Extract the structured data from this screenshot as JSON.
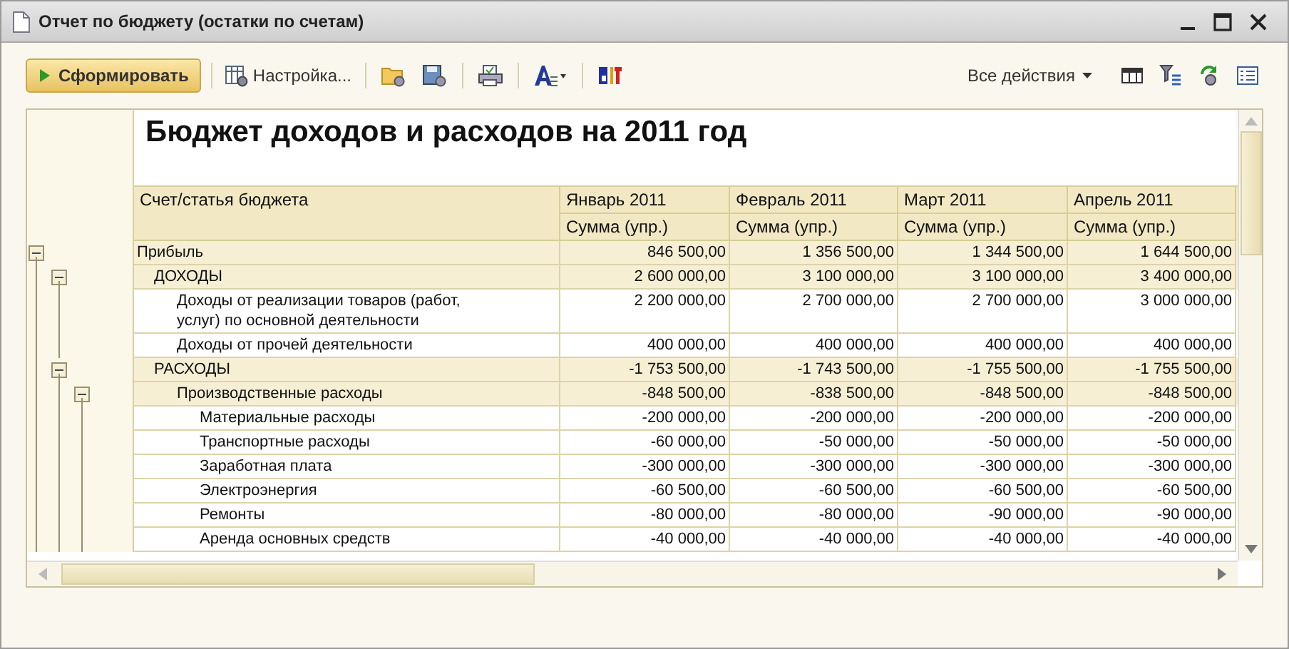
{
  "window": {
    "title": "Отчет по бюджету (остатки по счетам)"
  },
  "toolbar": {
    "generate_button": "Сформировать",
    "settings_button": "Настройка...",
    "actions_menu": "Все действия"
  },
  "report": {
    "title": "Бюджет доходов и расходов на 2011 год",
    "first_column": "Счет/статья бюджета",
    "columns": [
      {
        "month": "Январь 2011",
        "measure": "Сумма (упр.)"
      },
      {
        "month": "Февраль 2011",
        "measure": "Сумма (упр.)"
      },
      {
        "month": "Март 2011",
        "measure": "Сумма (упр.)"
      },
      {
        "month": "Апрель 2011",
        "measure": "Сумма (упр.)"
      }
    ],
    "rows": [
      {
        "label": "Прибыль",
        "values": [
          "846 500,00",
          "1 356 500,00",
          "1 344 500,00",
          "1 644 500,00"
        ],
        "expanded": true,
        "children": [
          {
            "label": "ДОХОДЫ",
            "values": [
              "2 600 000,00",
              "3 100 000,00",
              "3 100 000,00",
              "3 400 000,00"
            ],
            "expanded": true,
            "children": [
              {
                "label": "Доходы от реализации товаров (работ, услуг) по основной деятельности",
                "values": [
                  "2 200 000,00",
                  "2 700 000,00",
                  "2 700 000,00",
                  "3 000 000,00"
                ]
              },
              {
                "label": "Доходы от прочей деятельности",
                "values": [
                  "400 000,00",
                  "400 000,00",
                  "400 000,00",
                  "400 000,00"
                ]
              }
            ]
          },
          {
            "label": "РАСХОДЫ",
            "values": [
              "-1 753 500,00",
              "-1 743 500,00",
              "-1 755 500,00",
              "-1 755 500,00"
            ],
            "expanded": true,
            "children": [
              {
                "label": "Производственные расходы",
                "values": [
                  "-848 500,00",
                  "-838 500,00",
                  "-848 500,00",
                  "-848 500,00"
                ],
                "expanded": true,
                "children": [
                  {
                    "label": "Материальные расходы",
                    "values": [
                      "-200 000,00",
                      "-200 000,00",
                      "-200 000,00",
                      "-200 000,00"
                    ]
                  },
                  {
                    "label": "Транспортные расходы",
                    "values": [
                      "-60 000,00",
                      "-50 000,00",
                      "-50 000,00",
                      "-50 000,00"
                    ]
                  },
                  {
                    "label": "Заработная плата",
                    "values": [
                      "-300 000,00",
                      "-300 000,00",
                      "-300 000,00",
                      "-300 000,00"
                    ]
                  },
                  {
                    "label": "Электроэнергия",
                    "values": [
                      "-60 500,00",
                      "-60 500,00",
                      "-60 500,00",
                      "-60 500,00"
                    ]
                  },
                  {
                    "label": "Ремонты",
                    "values": [
                      "-80 000,00",
                      "-80 000,00",
                      "-90 000,00",
                      "-90 000,00"
                    ]
                  },
                  {
                    "label": "Аренда основных средств",
                    "values": [
                      "-40 000,00",
                      "-40 000,00",
                      "-40 000,00",
                      "-40 000,00"
                    ]
                  }
                ]
              }
            ]
          }
        ]
      }
    ]
  }
}
